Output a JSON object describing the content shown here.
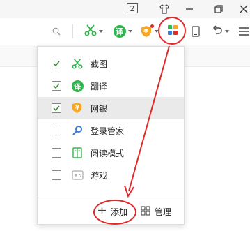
{
  "titlebar": {
    "tab_count": "2",
    "icons": [
      "tab-count-icon",
      "shirt-icon",
      "minimize-icon",
      "restore-icon",
      "close-icon"
    ]
  },
  "toolbar": {
    "icons": [
      "search-icon",
      "scissors-icon",
      "translate-icon",
      "wallet-icon",
      "apps-grid-icon",
      "tablet-icon",
      "undo-icon",
      "menu-icon"
    ],
    "translate_glyph": "译",
    "wallet_glyph": "¥"
  },
  "menu": {
    "items": [
      {
        "label": "截图",
        "checked": true,
        "icon": "scissors-icon",
        "glyph": ""
      },
      {
        "label": "翻译",
        "checked": true,
        "icon": "translate-icon",
        "glyph": "译"
      },
      {
        "label": "网银",
        "checked": true,
        "icon": "wallet-icon",
        "glyph": "¥"
      },
      {
        "label": "登录管家",
        "checked": false,
        "icon": "magnifier-key-icon",
        "glyph": ""
      },
      {
        "label": "阅读模式",
        "checked": false,
        "icon": "book-icon",
        "glyph": ""
      },
      {
        "label": "游戏",
        "checked": false,
        "icon": "gamepad-icon",
        "glyph": ""
      }
    ],
    "add_label": "添加",
    "manage_label": "管理"
  },
  "colors": {
    "accent_green": "#2db84d",
    "wallet_orange": "#f5a623",
    "annotation_red": "#e02a2a",
    "check_color": "#3a8f3a"
  }
}
